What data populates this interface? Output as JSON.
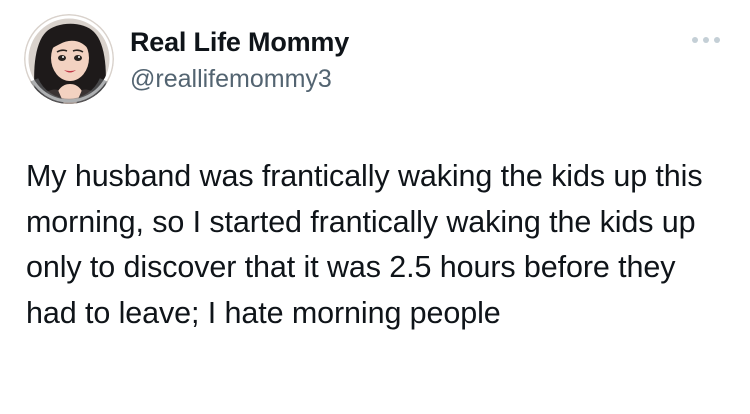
{
  "author": {
    "display_name": "Real Life Mommy",
    "handle": "@reallifemommy3",
    "avatar_icon": "avatar-illustration"
  },
  "menu": {
    "icon": "more-horizontal-icon"
  },
  "tweet": {
    "text": "My husband was frantically waking the kids up this morning, so I started frantically waking the kids up only to discover that it was 2.5 hours before they had to leave; I hate morning people"
  },
  "colors": {
    "text_primary": "#0f1419",
    "text_secondary": "#536471",
    "background": "#ffffff"
  }
}
